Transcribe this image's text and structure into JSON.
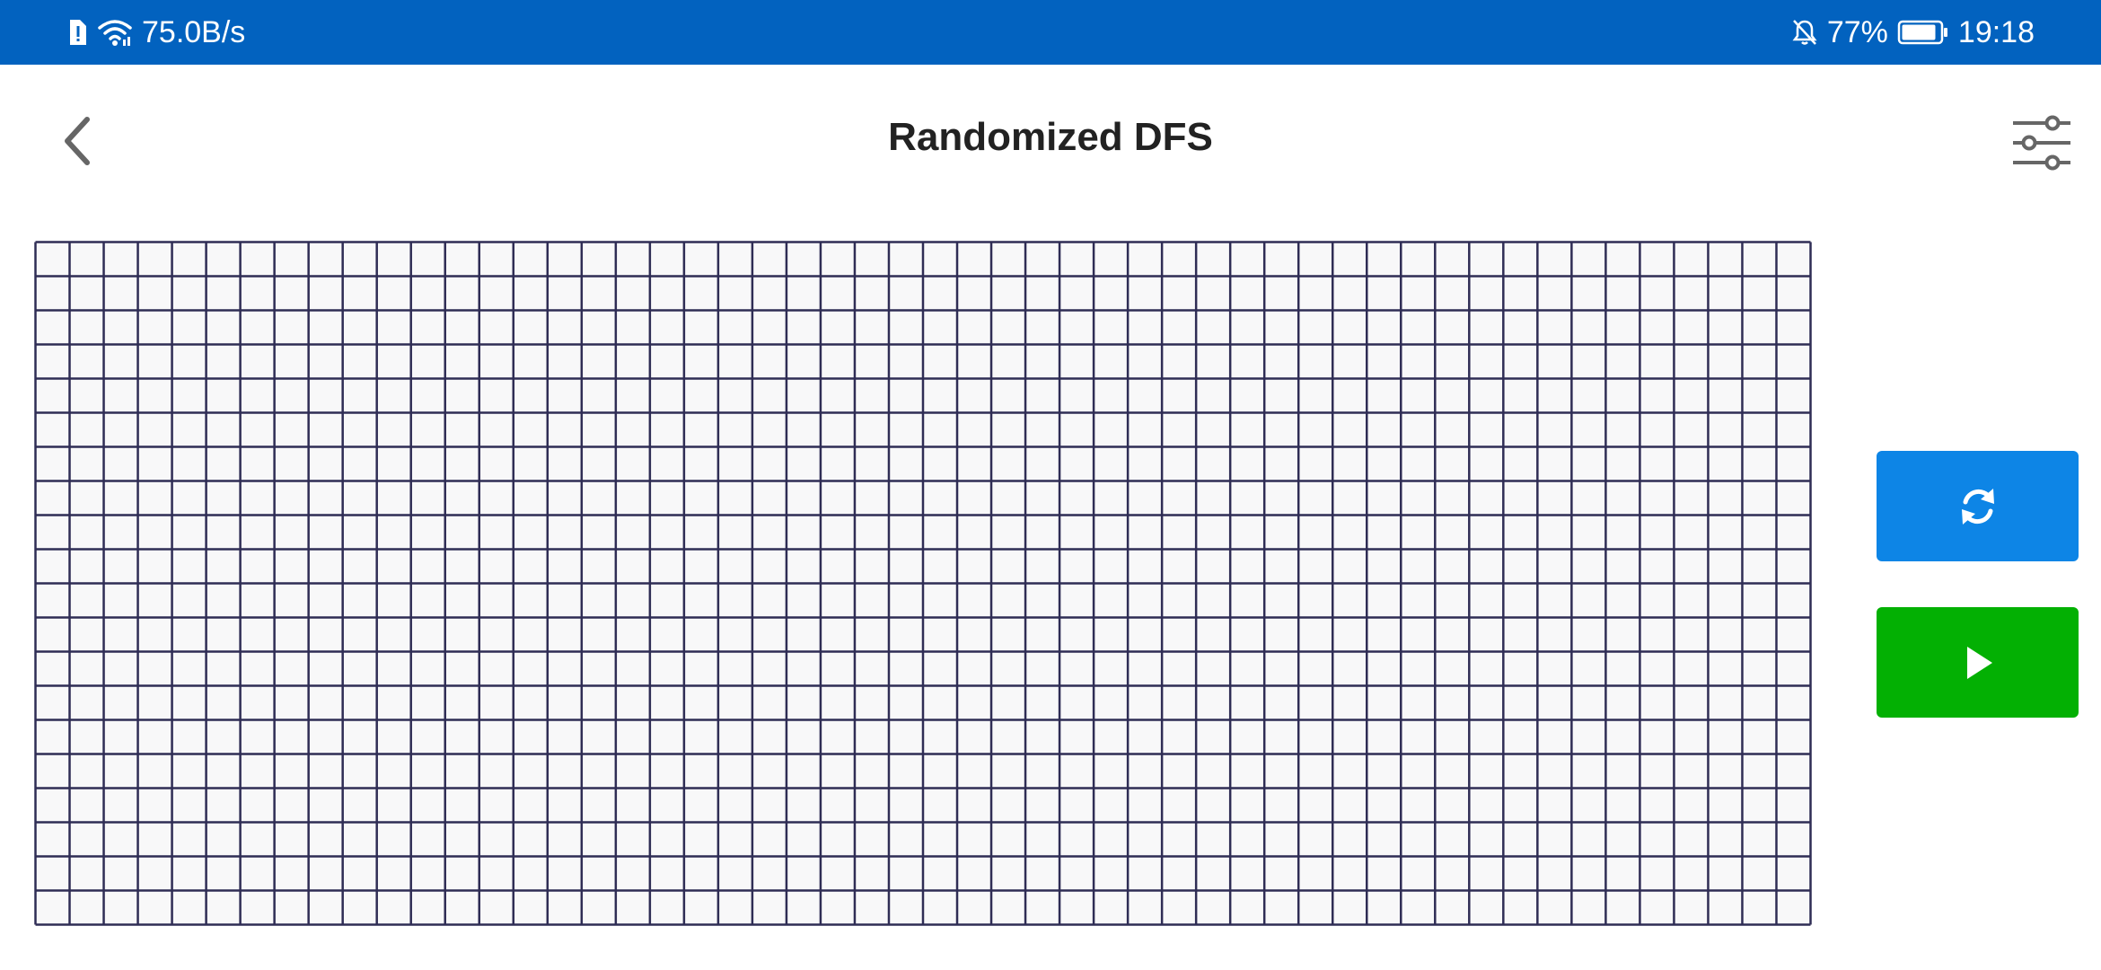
{
  "status_bar": {
    "network_speed": "75.0B/s",
    "battery_percent": "77%",
    "time": "19:18",
    "background": "#0262bf",
    "icons": [
      "sim-alert-icon",
      "wifi-icon",
      "bell-off-icon",
      "battery-icon"
    ],
    "battery_level": 0.77
  },
  "header": {
    "title": "Randomized DFS",
    "back_icon": "chevron-left-icon",
    "settings_icon": "sliders-icon"
  },
  "grid": {
    "columns": 52,
    "rows": 20,
    "line_color": "#2f2d55",
    "cell_color": "#f8f8f9"
  },
  "actions": {
    "reset": {
      "icon": "refresh-icon",
      "color": "#0d85e6"
    },
    "play": {
      "icon": "play-icon",
      "color": "#03b003"
    }
  }
}
